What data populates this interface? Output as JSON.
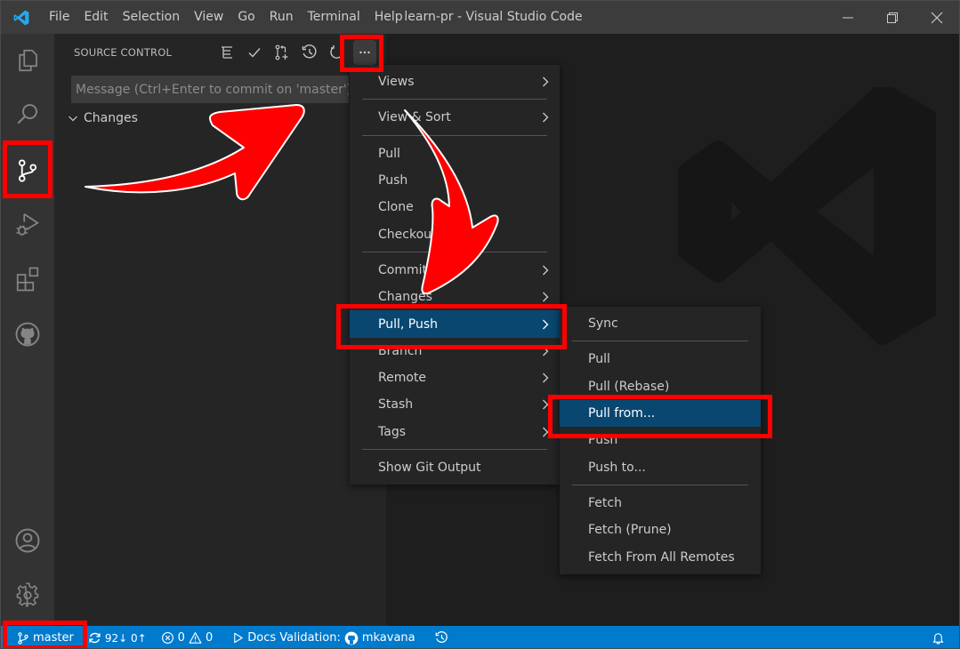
{
  "titlebar": {
    "menus": [
      "File",
      "Edit",
      "Selection",
      "View",
      "Go",
      "Run",
      "Terminal",
      "Help"
    ],
    "title": "learn-pr - Visual Studio Code",
    "controls": [
      "minimize-icon",
      "restore-icon",
      "close-icon"
    ]
  },
  "activitybar": {
    "items": [
      {
        "name": "explorer",
        "icon": "files-icon"
      },
      {
        "name": "search",
        "icon": "search-icon"
      },
      {
        "name": "source-control",
        "icon": "source-control-icon",
        "active": true
      },
      {
        "name": "run-debug",
        "icon": "run-debug-icon"
      },
      {
        "name": "extensions",
        "icon": "extensions-icon"
      },
      {
        "name": "github",
        "icon": "github-icon"
      }
    ],
    "bottom": [
      {
        "name": "accounts",
        "icon": "account-icon"
      },
      {
        "name": "manage",
        "icon": "gear-icon"
      }
    ]
  },
  "sidebar": {
    "title": "SOURCE CONTROL",
    "actions": [
      "tree-view-icon",
      "commit-check-icon",
      "create-pull-request-icon",
      "history-icon",
      "refresh-icon",
      "more-actions-icon"
    ],
    "commit_placeholder": "Message (Ctrl+Enter to commit on 'master')",
    "commit_value": "",
    "changes_label": "Changes"
  },
  "menu": {
    "groups": [
      [
        {
          "label": "Views",
          "submenu": true
        }
      ],
      [
        {
          "label": "View & Sort",
          "submenu": true
        }
      ],
      [
        {
          "label": "Pull"
        },
        {
          "label": "Push"
        },
        {
          "label": "Clone"
        },
        {
          "label": "Checkout to..."
        }
      ],
      [
        {
          "label": "Commit",
          "submenu": true
        },
        {
          "label": "Changes",
          "submenu": true
        },
        {
          "label": "Pull, Push",
          "submenu": true,
          "selected": true
        },
        {
          "label": "Branch",
          "submenu": true
        },
        {
          "label": "Remote",
          "submenu": true
        },
        {
          "label": "Stash",
          "submenu": true
        },
        {
          "label": "Tags",
          "submenu": true
        }
      ],
      [
        {
          "label": "Show Git Output"
        }
      ]
    ]
  },
  "submenu": {
    "groups": [
      [
        {
          "label": "Sync"
        }
      ],
      [
        {
          "label": "Pull"
        },
        {
          "label": "Pull (Rebase)"
        },
        {
          "label": "Pull from...",
          "selected": true
        },
        {
          "label": "Push"
        },
        {
          "label": "Push to..."
        }
      ],
      [
        {
          "label": "Fetch"
        },
        {
          "label": "Fetch (Prune)"
        },
        {
          "label": "Fetch From All Remotes"
        }
      ]
    ]
  },
  "statusbar": {
    "branch": "master",
    "sync": "92↓ 0↑",
    "errors": "0",
    "warnings": "0",
    "docs_validation": "Docs Validation:",
    "user": "mkavana"
  },
  "colors": {
    "accent": "#007acc",
    "selection": "#094771",
    "highlight": "#ff0000"
  }
}
